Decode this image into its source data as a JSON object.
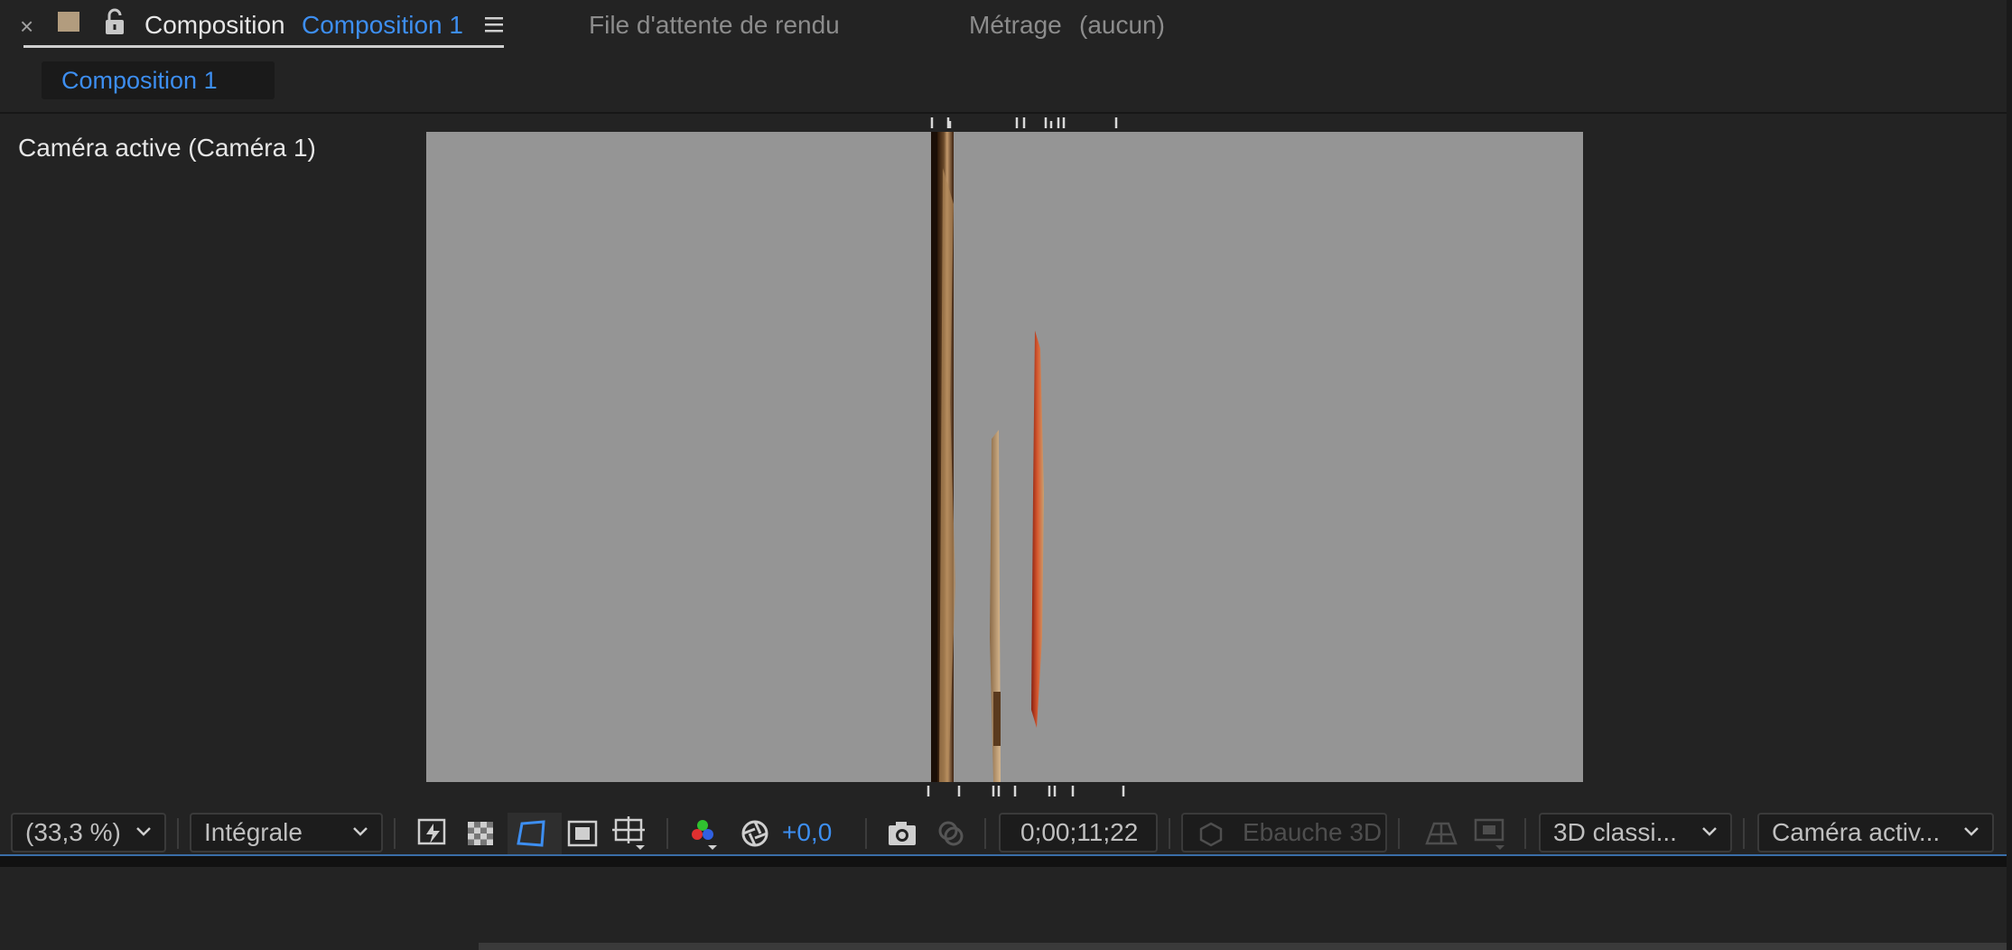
{
  "tabs": {
    "panel_label": "Composition",
    "comp_name": "Composition 1",
    "render_queue": "File d'attente de rendu",
    "footage_label": "Métrage",
    "footage_value": "(aucun)",
    "close_glyph": "×"
  },
  "subtab": {
    "label": "Composition 1"
  },
  "viewer": {
    "camera_label": "Caméra active (Caméra 1)",
    "background_color": "#959595"
  },
  "toolbar": {
    "zoom": "(33,3 %)",
    "resolution": "Intégrale",
    "exposure": "+0,0",
    "timecode": "0;00;11;22",
    "draft3d": "Ebauche 3D",
    "renderer": "3D  classi...",
    "view": "Caméra activ..."
  },
  "colors": {
    "accent": "#3d8ef0",
    "comp_swatch": "#b29c7e"
  }
}
